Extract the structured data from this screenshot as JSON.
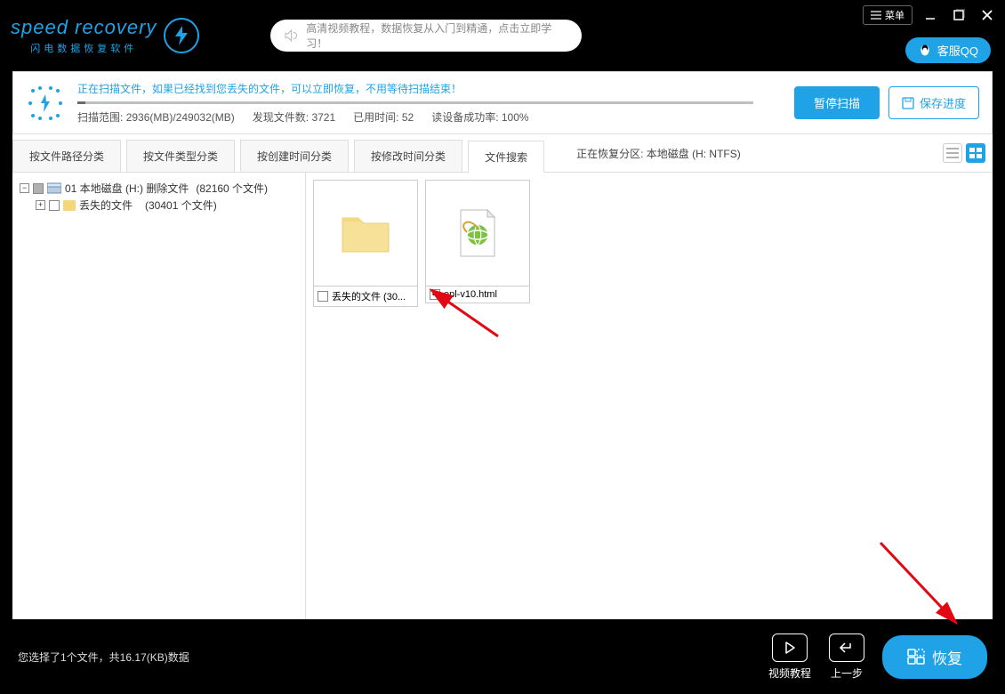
{
  "title_bar": {
    "brand_main": "speed recovery",
    "brand_sub": "闪电数据恢复软件",
    "tutorial_text": "高清视频教程，数据恢复从入门到精通，点击立即学习！",
    "menu_label": "菜单",
    "qq_label": "客服QQ"
  },
  "scan": {
    "message": "正在扫描文件，如果已经找到您丢失的文件，可以立即恢复，不用等待扫描结束！",
    "range_label": "扫描范围:",
    "range_value": "2936(MB)/249032(MB)",
    "found_label": "发现文件数:",
    "found_value": "3721",
    "time_label": "已用时间:",
    "time_value": "52",
    "success_label": "读设备成功率:",
    "success_value": "100%",
    "pause_label": "暂停扫描",
    "save_label": "保存进度"
  },
  "tabs": {
    "by_path": "按文件路径分类",
    "by_type": "按文件类型分类",
    "by_create": "按创建时间分类",
    "by_modify": "按修改时间分类",
    "search": "文件搜索",
    "partition_label": "正在恢复分区: 本地磁盘 (H: NTFS)"
  },
  "tree": {
    "root_label": "01 本地磁盘 (H:) 删除文件",
    "root_count": "(82160 个文件)",
    "child_label": "丢失的文件",
    "child_count": "(30401 个文件)"
  },
  "files": {
    "tile1_label": "丢失的文件 (30...",
    "tile2_label": "epl-v10.html"
  },
  "footer": {
    "status": "您选择了1个文件，共16.17(KB)数据",
    "video_label": "视频教程",
    "back_label": "上一步",
    "recover_label": "恢复"
  }
}
